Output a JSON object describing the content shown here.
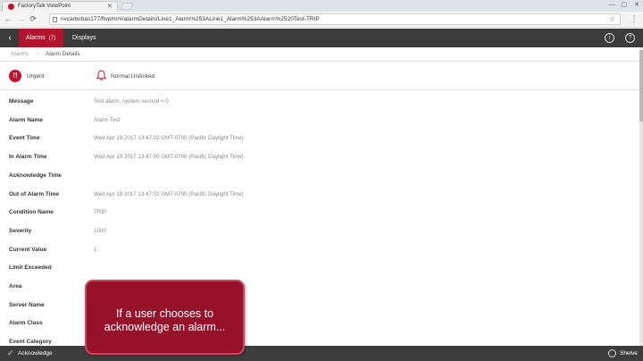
{
  "browser": {
    "tab_title": "FactoryTalk ViewPoint",
    "url": "nvcarbcbas177/ftvp/m/#/alarmDetails/Line1_Alarm%253ALine1_Alarm%253AAlarm%2520Test-TRIP"
  },
  "appbar": {
    "alarms_label": "Alarms",
    "alarms_count": "(7)",
    "displays_label": "Displays"
  },
  "breadcrumb": {
    "root": "Alarms",
    "current": "Alarm Details"
  },
  "status": {
    "severity_label": "Urgent",
    "state": "Normal,UnAcked",
    "accent": "#c8102e"
  },
  "details": [
    {
      "label": "Message",
      "value": "Test alarm, system second = 0"
    },
    {
      "label": "Alarm Name",
      "value": "Alarm Test"
    },
    {
      "label": "Event Time",
      "value": "Wed Apr 19 2017 13:47:02 GMT-0700 (Pacific Daylight Time)"
    },
    {
      "label": "In Alarm Time",
      "value": "Wed Apr 19 2017 13:47:00 GMT-0700 (Pacific Daylight Time)"
    },
    {
      "label": "Acknowledge Time",
      "value": ""
    },
    {
      "label": "Out of Alarm Time",
      "value": "Wed Apr 19 2017 13:47:02 GMT-0700 (Pacific Daylight Time)"
    },
    {
      "label": "Condition Name",
      "value": "TRIP"
    },
    {
      "label": "Severity",
      "value": "1000"
    },
    {
      "label": "Current Value",
      "value": "1"
    },
    {
      "label": "Limit Exceeded",
      "value": ""
    },
    {
      "label": "Area",
      "value": ""
    },
    {
      "label": "Server Name",
      "value": ""
    },
    {
      "label": "Alarm Class",
      "value": ""
    },
    {
      "label": "Event Category",
      "value": ""
    }
  ],
  "bottombar": {
    "acknowledge_label": "Acknowledge",
    "shelve_label": "Shelve"
  },
  "callout": {
    "line1": "If a user chooses to",
    "line2": "acknowledge an alarm..."
  }
}
